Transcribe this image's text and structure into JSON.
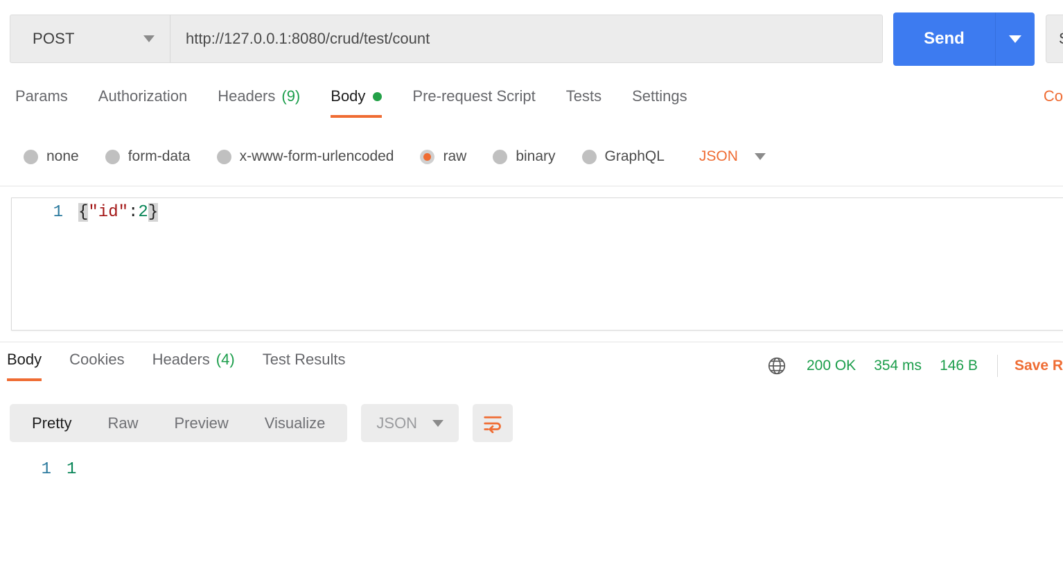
{
  "request_bar": {
    "method": "POST",
    "method_caret_icon": "chevron-down-icon",
    "url": "http://127.0.0.1:8080/crud/test/count",
    "url_placeholder": "Enter request URL",
    "send_label": "Send",
    "send_caret_icon": "chevron-down-icon",
    "save_label": "S",
    "send_color": "#3d7bf0"
  },
  "request_tabs": {
    "items": [
      {
        "label": "Params",
        "count": "",
        "active": false,
        "dot": false
      },
      {
        "label": "Authorization",
        "count": "",
        "active": false,
        "dot": false
      },
      {
        "label": "Headers",
        "count": "(9)",
        "active": false,
        "dot": false
      },
      {
        "label": "Body",
        "count": "",
        "active": true,
        "dot": true
      },
      {
        "label": "Pre-request Script",
        "count": "",
        "active": false,
        "dot": false
      },
      {
        "label": "Tests",
        "count": "",
        "active": false,
        "dot": false
      },
      {
        "label": "Settings",
        "count": "",
        "active": false,
        "dot": false
      }
    ],
    "cookies_link": "Co",
    "active_underline_color": "#ef6c33",
    "count_color": "#1a9d4a",
    "dot_color": "#24a148"
  },
  "body_type": {
    "options": [
      {
        "label": "none",
        "selected": false
      },
      {
        "label": "form-data",
        "selected": false
      },
      {
        "label": "x-www-form-urlencoded",
        "selected": false
      },
      {
        "label": "raw",
        "selected": true
      },
      {
        "label": "binary",
        "selected": false
      },
      {
        "label": "GraphQL",
        "selected": false
      }
    ],
    "format": "JSON",
    "format_caret_icon": "chevron-down-icon",
    "selected_color": "#ef6c33"
  },
  "request_editor": {
    "line_number": "1",
    "tokens": {
      "open_brace": "{",
      "key": "\"id\"",
      "colon": ":",
      "value": "2",
      "close_brace": "}"
    },
    "raw_text": "{\"id\":2}"
  },
  "response_tabs": {
    "items": [
      {
        "label": "Body",
        "count": "",
        "active": true
      },
      {
        "label": "Cookies",
        "count": "",
        "active": false
      },
      {
        "label": "Headers",
        "count": "(4)",
        "active": false
      },
      {
        "label": "Test Results",
        "count": "",
        "active": false
      }
    ]
  },
  "response_status": {
    "globe_icon": "globe-icon",
    "status": "200 OK",
    "time": "354 ms",
    "size": "146 B",
    "save_response": "Save R",
    "status_color": "#1a9d4a",
    "save_color": "#ef6c33"
  },
  "response_toolbar": {
    "views": [
      {
        "label": "Pretty",
        "active": true
      },
      {
        "label": "Raw",
        "active": false
      },
      {
        "label": "Preview",
        "active": false
      },
      {
        "label": "Visualize",
        "active": false
      }
    ],
    "format": "JSON",
    "format_caret_icon": "chevron-down-icon",
    "wrap_icon": "word-wrap-icon",
    "wrap_icon_color": "#ef6c33"
  },
  "response_body": {
    "line_number": "1",
    "value": "1"
  }
}
